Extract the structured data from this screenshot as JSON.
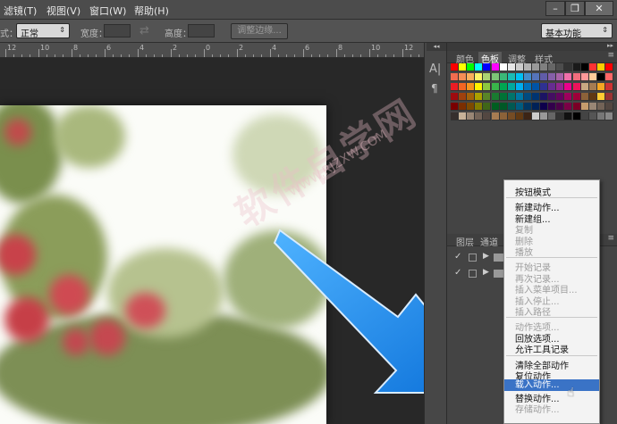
{
  "menubar": {
    "items": [
      "滤镜(T)",
      "视图(V)",
      "窗口(W)",
      "帮助(H)"
    ],
    "window_controls": {
      "minimize": "–",
      "restore": "❐",
      "close": "✕"
    }
  },
  "options": {
    "style_label": "式：",
    "style_value": "正常",
    "width_label": "宽度：",
    "height_label": "高度：",
    "refine_button": "调整边缘...",
    "workspace_value": "基本功能"
  },
  "ruler": {
    "ticks": [
      "12",
      "10",
      "8",
      "6",
      "4",
      "2",
      "0",
      "2",
      "4",
      "6",
      "8",
      "10",
      "12"
    ]
  },
  "panels": {
    "top_tabs": [
      "颜色",
      "色板",
      "调整",
      "样式"
    ],
    "active_top_tab": "色板",
    "bottom_tabs": [
      "图层",
      "通道"
    ]
  },
  "context_menu": {
    "groups": [
      [
        {
          "label": "按钮模式",
          "disabled": false
        }
      ],
      [
        {
          "label": "新建动作...",
          "disabled": false
        },
        {
          "label": "新建组...",
          "disabled": false
        },
        {
          "label": "复制",
          "disabled": true
        },
        {
          "label": "删除",
          "disabled": true
        },
        {
          "label": "播放",
          "disabled": true
        }
      ],
      [
        {
          "label": "开始记录",
          "disabled": true
        },
        {
          "label": "再次记录...",
          "disabled": true
        },
        {
          "label": "插入菜单项目...",
          "disabled": true
        },
        {
          "label": "插入停止...",
          "disabled": true
        },
        {
          "label": "插入路径",
          "disabled": true
        }
      ],
      [
        {
          "label": "动作选项...",
          "disabled": true
        },
        {
          "label": "回放选项...",
          "disabled": false
        },
        {
          "label": "允许工具记录",
          "disabled": false
        }
      ],
      [
        {
          "label": "清除全部动作",
          "disabled": false
        },
        {
          "label": "复位动作",
          "disabled": false
        },
        {
          "label": "载入动作...",
          "disabled": false,
          "highlighted": true
        },
        {
          "label": "替换动作...",
          "disabled": false
        },
        {
          "label": "存储动作...",
          "disabled": true
        }
      ]
    ]
  },
  "watermark": {
    "text": "软件自学网",
    "url": "WWW.RJZXW.COM"
  },
  "colors": {
    "accent_arrow": "#1e8cf0",
    "highlight": "#3a73c6"
  }
}
